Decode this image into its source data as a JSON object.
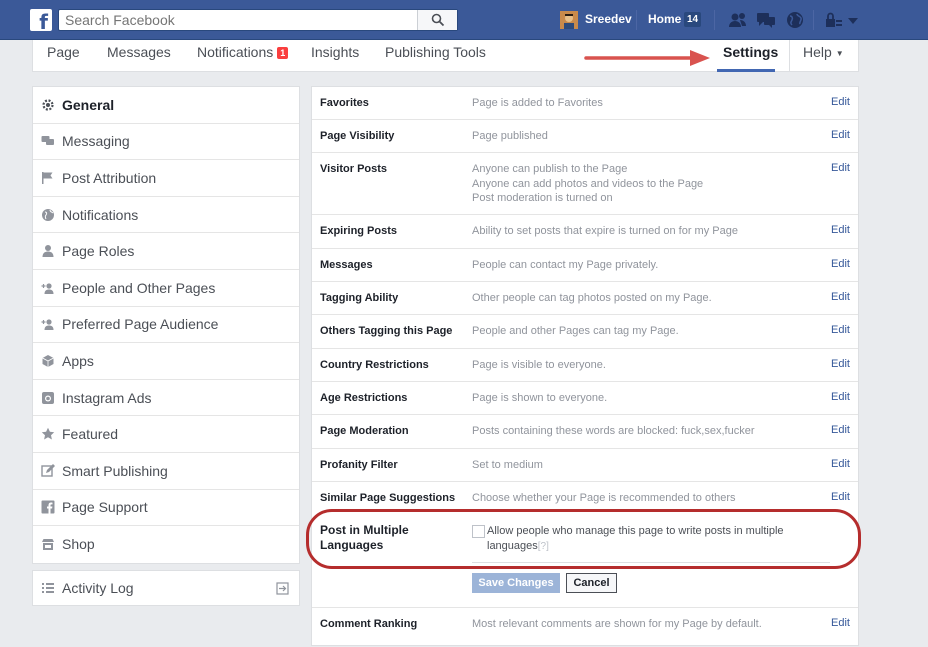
{
  "topbar": {
    "logo": "f",
    "search_placeholder": "Search Facebook",
    "user_name": "Sreedev",
    "home_label": "Home",
    "home_count": "14"
  },
  "page_tabs": [
    {
      "label": "Page"
    },
    {
      "label": "Messages"
    },
    {
      "label": "Notifications",
      "badge": "1"
    },
    {
      "label": "Insights"
    },
    {
      "label": "Publishing Tools"
    },
    {
      "label": "Settings"
    },
    {
      "label": "Help"
    }
  ],
  "sidebar": {
    "items": [
      {
        "label": "General",
        "icon": "gear-icon"
      },
      {
        "label": "Messaging",
        "icon": "chat-icon"
      },
      {
        "label": "Post Attribution",
        "icon": "flag-icon"
      },
      {
        "label": "Notifications",
        "icon": "globe-icon"
      },
      {
        "label": "Page Roles",
        "icon": "person-icon"
      },
      {
        "label": "People and Other Pages",
        "icon": "person-plus-icon"
      },
      {
        "label": "Preferred Page Audience",
        "icon": "person-plus-icon"
      },
      {
        "label": "Apps",
        "icon": "cube-icon"
      },
      {
        "label": "Instagram Ads",
        "icon": "camera-icon"
      },
      {
        "label": "Featured",
        "icon": "star-icon"
      },
      {
        "label": "Smart Publishing",
        "icon": "edit-icon"
      },
      {
        "label": "Page Support",
        "icon": "facebook-icon"
      },
      {
        "label": "Shop",
        "icon": "shop-icon"
      }
    ],
    "activity_log": "Activity Log"
  },
  "settings": {
    "edit_label": "Edit",
    "rows": [
      {
        "label": "Favorites",
        "value": "Page is added to Favorites"
      },
      {
        "label": "Page Visibility",
        "value": "Page published"
      },
      {
        "label": "Visitor Posts",
        "value": "Anyone can publish to the Page",
        "value2": "Anyone can add photos and videos to the Page",
        "value3": "Post moderation is turned on"
      },
      {
        "label": "Expiring Posts",
        "value": "Ability to set posts that expire is turned on for my Page"
      },
      {
        "label": "Messages",
        "value": "People can contact my Page privately."
      },
      {
        "label": "Tagging Ability",
        "value": "Other people can tag photos posted on my Page."
      },
      {
        "label": "Others Tagging this Page",
        "value": "People and other Pages can tag my Page."
      },
      {
        "label": "Country Restrictions",
        "value": "Page is visible to everyone."
      },
      {
        "label": "Age Restrictions",
        "value": "Page is shown to everyone."
      },
      {
        "label": "Page Moderation",
        "value": "Posts containing these words are blocked: fuck,sex,fucker"
      },
      {
        "label": "Profanity Filter",
        "value": "Set to medium"
      },
      {
        "label": "Similar Page Suggestions",
        "value": "Choose whether your Page is recommended to others"
      }
    ],
    "multi_lang": {
      "label": "Post in Multiple Languages",
      "checkbox_text": "Allow people who manage this page to write posts in multiple languages",
      "help_mark": "[?]",
      "checked": false,
      "save_label": "Save Changes",
      "cancel_label": "Cancel"
    },
    "comment_ranking": {
      "label": "Comment Ranking",
      "value": "Most relevant comments are shown for my Page by default."
    }
  },
  "colors": {
    "brand": "#3b5998",
    "highlight": "#b52d2d",
    "arrow": "#d9534f",
    "link": "#365899"
  }
}
